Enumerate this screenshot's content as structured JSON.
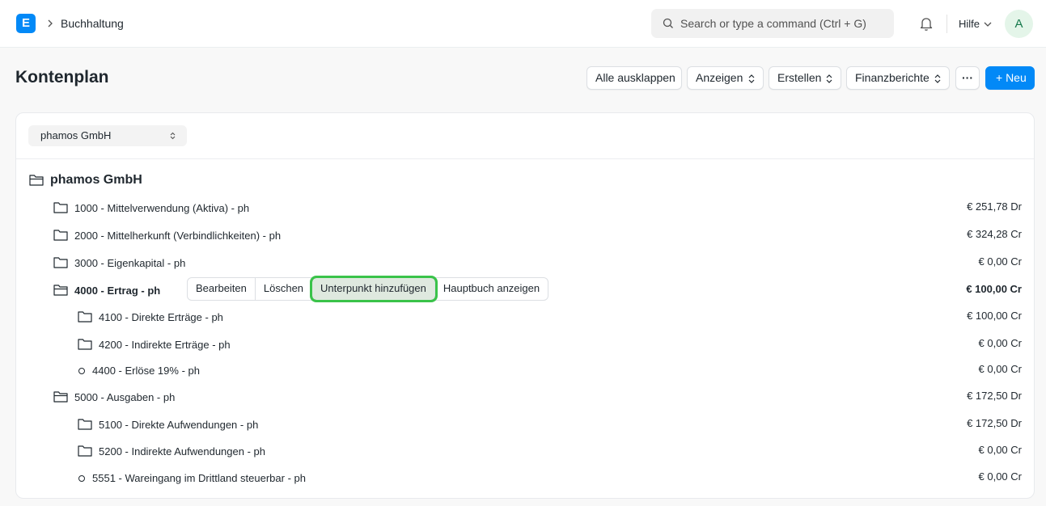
{
  "navbar": {
    "logo_letter": "E",
    "breadcrumb": "Buchhaltung",
    "search_placeholder": "Search or type a command (Ctrl + G)",
    "help_label": "Hilfe",
    "avatar_letter": "A"
  },
  "page": {
    "title": "Kontenplan",
    "buttons": {
      "expand_all": "Alle ausklappen",
      "view": "Anzeigen",
      "create": "Erstellen",
      "reports": "Finanzberichte",
      "more": "···",
      "new": "+ Neu"
    }
  },
  "company_select": {
    "value": "phamos GmbH"
  },
  "tree": {
    "root": "phamos GmbH",
    "rows": [
      {
        "label": "1000 - Mittelverwendung (Aktiva) - ph",
        "balance": "€ 251,78 Dr"
      },
      {
        "label": "2000 - Mittelherkunft (Verbindlichkeiten) - ph",
        "balance": "€ 324,28 Cr"
      },
      {
        "label": "3000 - Eigenkapital - ph",
        "balance": "€ 0,00 Cr"
      },
      {
        "label": "4000 - Ertrag - ph",
        "balance": "€ 100,00 Cr"
      },
      {
        "label": "4100 - Direkte Erträge - ph",
        "balance": "€ 100,00 Cr"
      },
      {
        "label": "4200 - Indirekte Erträge - ph",
        "balance": "€ 0,00 Cr"
      },
      {
        "label": "4400 - Erlöse 19% - ph",
        "balance": "€ 0,00 Cr"
      },
      {
        "label": "5000 - Ausgaben - ph",
        "balance": "€ 172,50 Dr"
      },
      {
        "label": "5100 - Direkte Aufwendungen - ph",
        "balance": "€ 172,50 Dr"
      },
      {
        "label": "5200 - Indirekte Aufwendungen - ph",
        "balance": "€ 0,00 Cr"
      },
      {
        "label": "5551 - Wareingang im Drittland steuerbar - ph",
        "balance": "€ 0,00 Cr"
      }
    ]
  },
  "row_actions": {
    "edit": "Bearbeiten",
    "delete": "Löschen",
    "add_child": "Unterpunkt hinzufügen",
    "view_ledger": "Hauptbuch anzeigen"
  },
  "colors": {
    "primary": "#0289f7",
    "highlight": "#3ac34a"
  }
}
